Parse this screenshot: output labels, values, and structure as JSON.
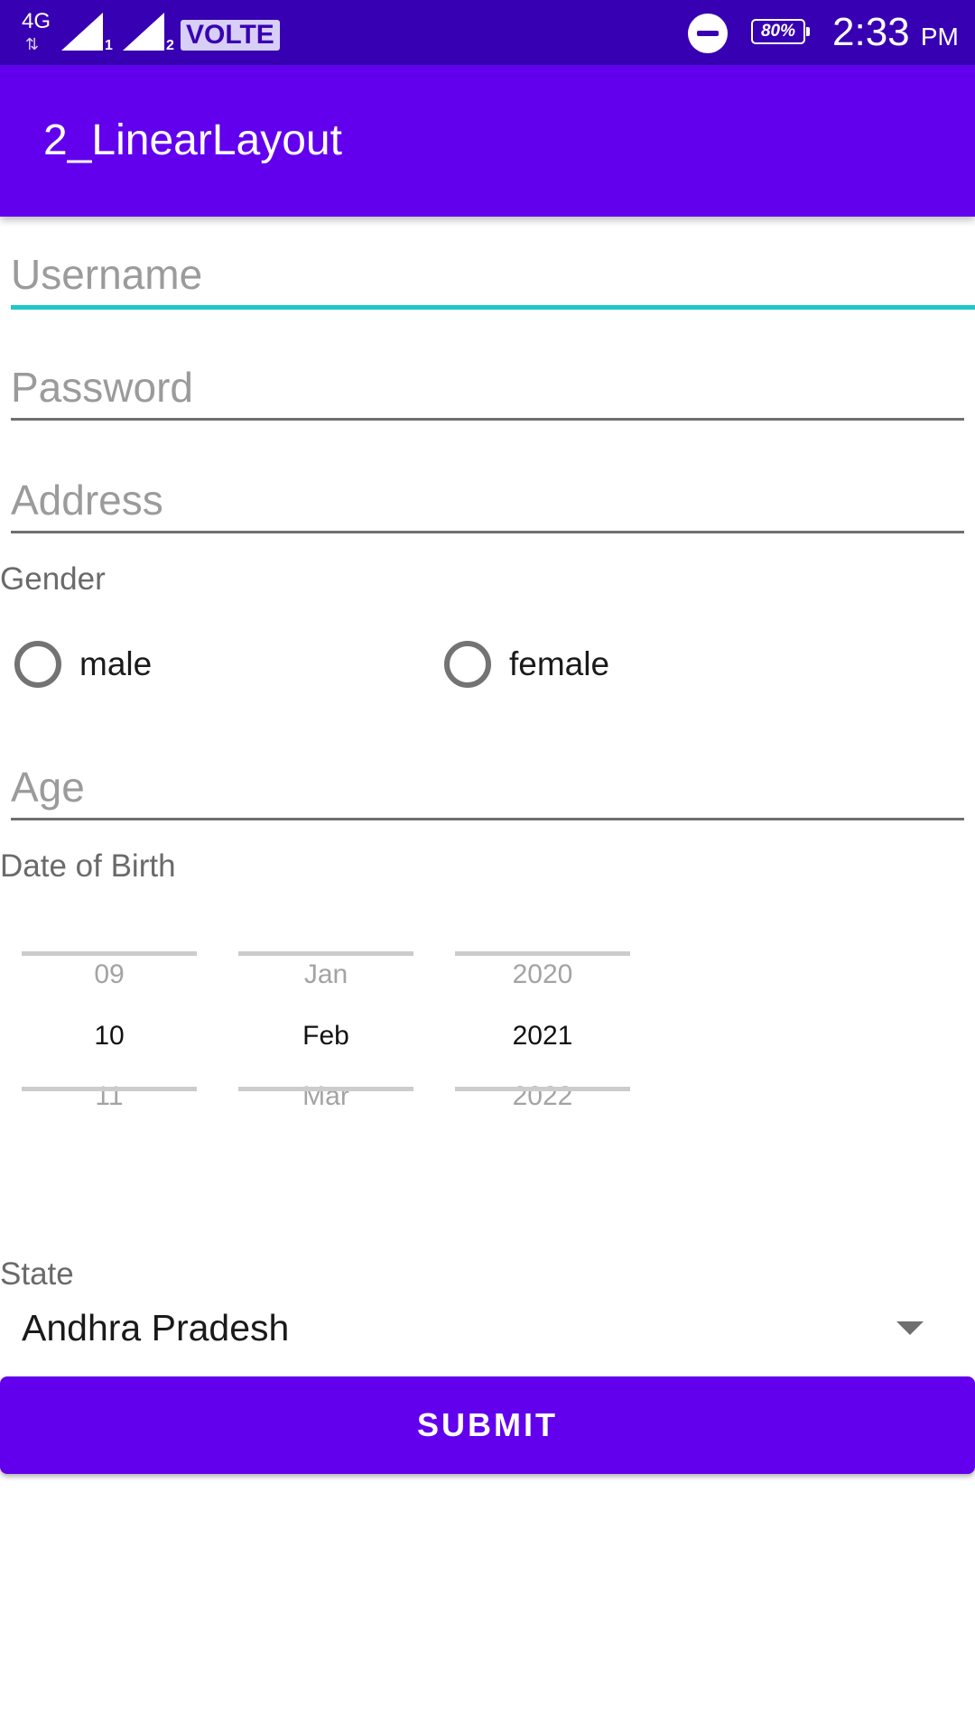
{
  "status_bar": {
    "network": "4G",
    "network_arrows": "⇅",
    "sim1": "1",
    "sim2": "2",
    "volte": "VOLTE",
    "battery": "80%",
    "time": "2:33",
    "ampm": "PM"
  },
  "app_bar": {
    "title": "2_LinearLayout"
  },
  "form": {
    "username": {
      "placeholder": "Username",
      "value": ""
    },
    "password": {
      "placeholder": "Password",
      "value": ""
    },
    "address": {
      "placeholder": "Address",
      "value": ""
    },
    "gender": {
      "label": "Gender",
      "options": [
        {
          "label": "male",
          "checked": false
        },
        {
          "label": "female",
          "checked": false
        }
      ]
    },
    "age": {
      "placeholder": "Age",
      "value": ""
    },
    "dob": {
      "label": "Date of Birth",
      "day": {
        "prev": "09",
        "selected": "10",
        "next": "11"
      },
      "month": {
        "prev": "Jan",
        "selected": "Feb",
        "next": "Mar"
      },
      "year": {
        "prev": "2020",
        "selected": "2021",
        "next": "2022"
      }
    },
    "state": {
      "label": "State",
      "selected": "Andhra Pradesh"
    },
    "submit_label": "SUBMIT"
  },
  "colors": {
    "status_bar": "#3700b3",
    "primary": "#6200ee",
    "focus_underline": "#1dc8c8"
  }
}
